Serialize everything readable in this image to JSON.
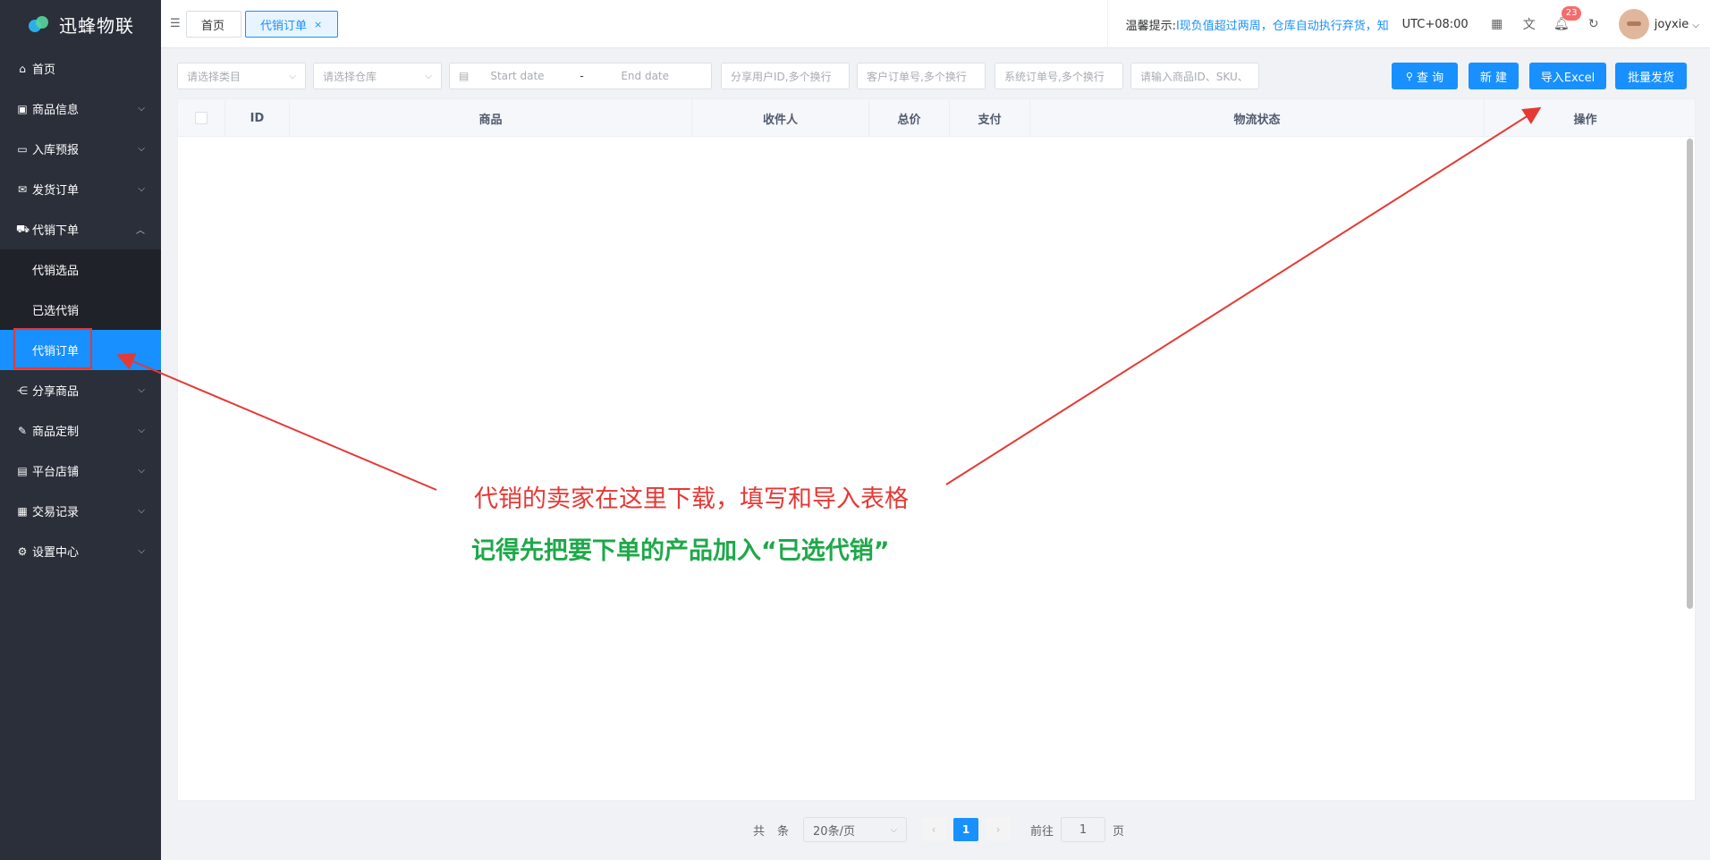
{
  "app": {
    "title": "迅蜂物联"
  },
  "sidebar": {
    "items": [
      {
        "label": "首页",
        "icon": "home-icon",
        "glyph": "⌂"
      },
      {
        "label": "商品信息",
        "icon": "gift-icon",
        "glyph": "▣"
      },
      {
        "label": "入库预报",
        "icon": "folder-icon",
        "glyph": "▭"
      },
      {
        "label": "发货订单",
        "icon": "mail-icon",
        "glyph": "✉"
      },
      {
        "label": "代销下单",
        "icon": "cart-icon",
        "glyph": "⛟"
      },
      {
        "label": "代销选品"
      },
      {
        "label": "已选代销"
      },
      {
        "label": "代销订单"
      },
      {
        "label": "分享商品",
        "icon": "share-icon",
        "glyph": "⋲"
      },
      {
        "label": "商品定制",
        "icon": "customize-icon",
        "glyph": "✎"
      },
      {
        "label": "平台店铺",
        "icon": "store-icon",
        "glyph": "▤"
      },
      {
        "label": "交易记录",
        "icon": "record-icon",
        "glyph": "▦"
      },
      {
        "label": "设置中心",
        "icon": "settings-icon",
        "glyph": "⚙"
      }
    ]
  },
  "header": {
    "tabs": [
      {
        "label": "首页"
      },
      {
        "label": "代销订单",
        "close": "×"
      }
    ],
    "tip_label": "温馨提示:",
    "tip_text": "I现负值超过两周，仓库自动执行弃货，知",
    "timezone": "UTC+08:00",
    "notification_count": "23",
    "username": "joyxie",
    "icons": [
      "grid-icon",
      "translate-icon",
      "bell-icon",
      "refresh-icon"
    ]
  },
  "filters": {
    "category": "请选择类目",
    "warehouse": "请选择仓库",
    "start_date": "Start date",
    "date_sep": "-",
    "end_date": "End date",
    "share_user": "分享用户ID,多个换行",
    "customer_order": "客户订单号,多个换行",
    "system_order": "系统订单号,多个换行",
    "product_search": "请输入商品ID、SKU、"
  },
  "buttons": {
    "query": "查 询",
    "create": "新 建",
    "import_excel": "导入Excel",
    "batch_ship": "批量发货"
  },
  "table": {
    "columns": [
      "ID",
      "商品",
      "收件人",
      "总价",
      "支付",
      "物流状态",
      "操作"
    ]
  },
  "pagination": {
    "total_prefix": "共",
    "total_suffix": "条",
    "page_size": "20条/页",
    "current_page": "1",
    "goto_label": "前往",
    "goto_value": "1",
    "page_suffix": "页"
  },
  "annotations": {
    "line1": "代销的卖家在这里下载，填写和导入表格",
    "line2": "记得先把要下单的产品加入“已选代销”",
    "line1_color": "#e53935",
    "line2_color": "#1fa84a"
  },
  "colors": {
    "primary": "#1890ff",
    "sidebar_bg": "#2b2f3a"
  }
}
